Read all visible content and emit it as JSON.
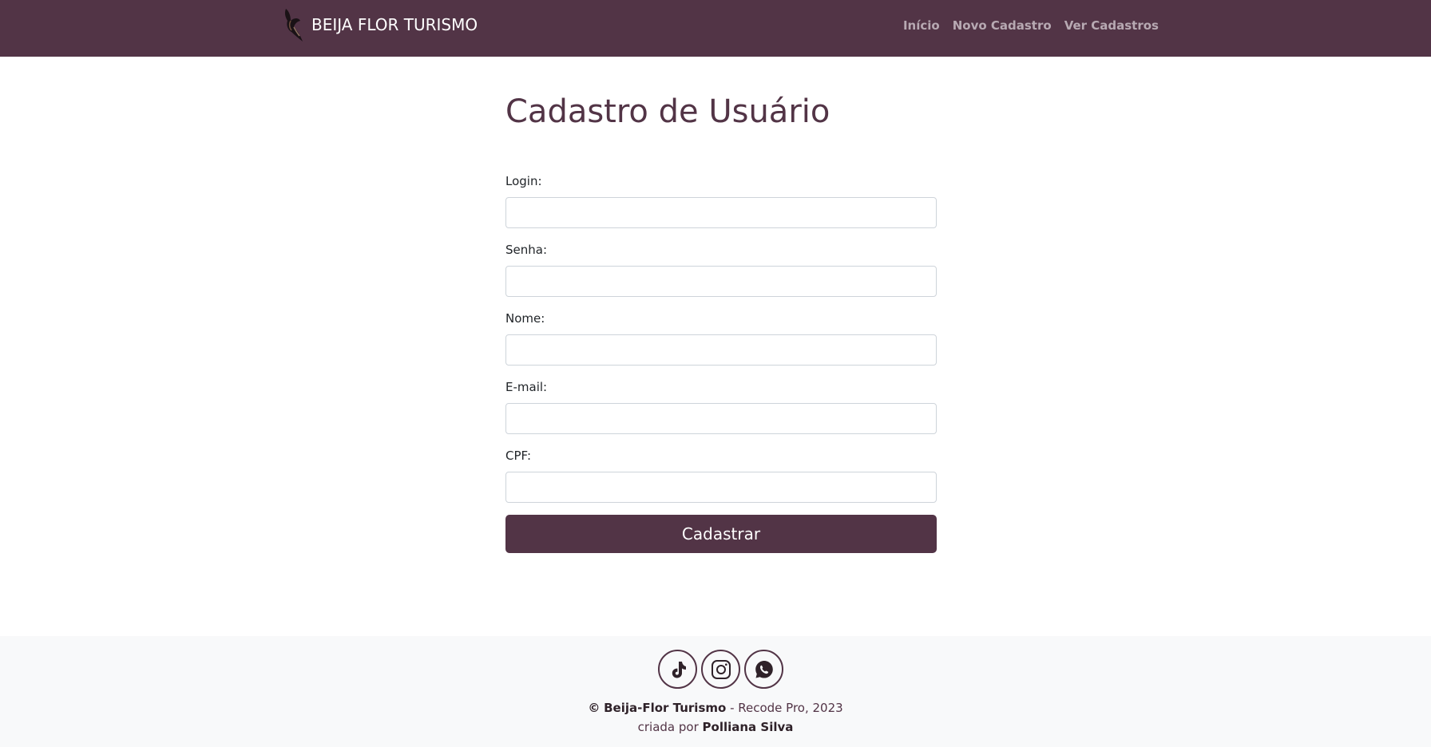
{
  "navbar": {
    "brand": "BEIJA FLOR TURISMO",
    "links": [
      "Início",
      "Novo Cadastro",
      "Ver Cadastros"
    ]
  },
  "page": {
    "title": "Cadastro de Usuário"
  },
  "form": {
    "fields": [
      {
        "label": "Login:",
        "value": ""
      },
      {
        "label": "Senha:",
        "value": ""
      },
      {
        "label": "Nome:",
        "value": ""
      },
      {
        "label": "E-mail:",
        "value": ""
      },
      {
        "label": "CPF:",
        "value": ""
      }
    ],
    "submit_label": "Cadastrar"
  },
  "footer": {
    "socials": [
      "tiktok-icon",
      "instagram-icon",
      "whatsapp-icon"
    ],
    "copyright_symbol": "©",
    "company": "Beija-Flor Turismo",
    "copyright_rest": " - Recode Pro, 2023",
    "credit_prefix": "criada por ",
    "author": "Polliana Silva"
  },
  "colors": {
    "brand": "#523446",
    "nav_link": "#b7a9b2",
    "footer_bg": "#f8f9fa"
  }
}
